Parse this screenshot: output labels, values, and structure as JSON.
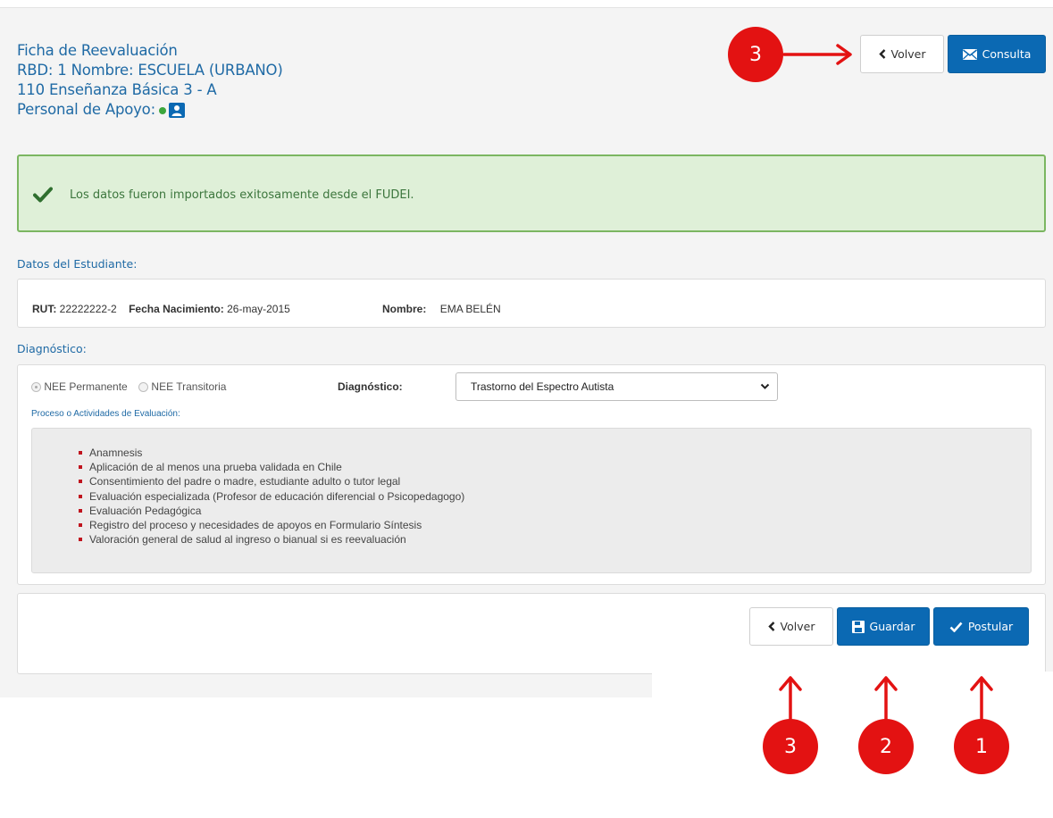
{
  "header": {
    "title": "Ficha de Reevaluación",
    "rbd_line": "RBD: 1 Nombre:  ESCUELA   (URBANO)",
    "course_line": "110 Enseñanza Básica 3 - A",
    "support_label": "Personal de Apoyo:"
  },
  "top_buttons": {
    "back_label": "Volver",
    "consult_label": "Consulta"
  },
  "alert": {
    "message": "Los datos fueron importados exitosamente desde el FUDEI."
  },
  "student": {
    "section_label": "Datos del Estudiante:",
    "rut_label": "RUT:",
    "rut_value": "22222222-2",
    "birth_label": "Fecha Nacimiento:",
    "birth_value": "26-may-2015",
    "name_label": "Nombre:",
    "name_value": "EMA BELÉN"
  },
  "diagnosis": {
    "section_label": "Diagnóstico:",
    "radio_permanent": "NEE Permanente",
    "radio_transitory": "NEE Transitoria",
    "select_label": "Diagnóstico:",
    "select_value": "Trastorno del Espectro Autista",
    "process_label": "Proceso o Actividades de Evaluación:",
    "items": [
      "Anamnesis",
      "Aplicación de al menos una prueba validada en Chile",
      "Consentimiento del padre o madre, estudiante adulto o tutor legal",
      "Evaluación especializada (Profesor de educación diferencial o Psicopedagogo)",
      "Evaluación Pedagógica",
      "Registro del proceso y necesidades de apoyos en Formulario Síntesis",
      "Valoración general de salud al ingreso o bianual si es reevaluación"
    ]
  },
  "footer_buttons": {
    "back_label": "Volver",
    "save_label": "Guardar",
    "submit_label": "Postular"
  },
  "annotations": {
    "top_back": "3",
    "bottom_back": "3",
    "save": "2",
    "submit": "1"
  },
  "colors": {
    "primary": "#0b69b3",
    "title": "#1f6aa5",
    "alert_bg": "#dff0d8",
    "alert_text": "#3c763d",
    "annotation": "#e31212"
  }
}
